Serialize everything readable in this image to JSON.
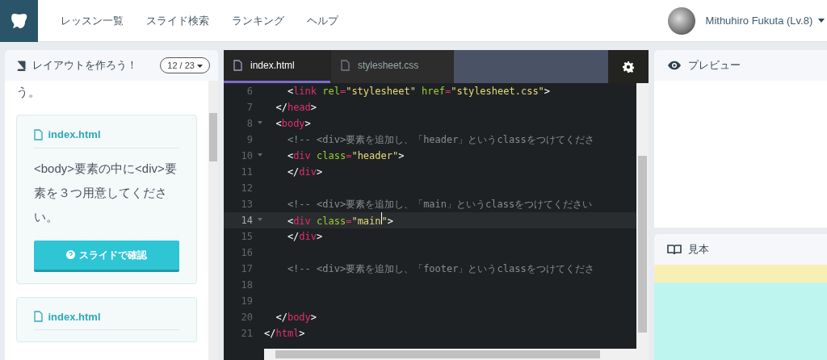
{
  "nav": {
    "items": [
      "レッスン一覧",
      "スライド検索",
      "ランキング",
      "ヘルプ"
    ],
    "user": "Mithuhiro Fukuta (Lv.8)"
  },
  "lesson": {
    "title": "レイアウトを作ろう！",
    "progress": "12 / 23",
    "intro_tail": "う。",
    "cards": [
      {
        "file": "index.html",
        "text": "<body>要素の中に<div>要素を３つ用意してください。",
        "button": "スライドで確認"
      },
      {
        "file": "index.html"
      }
    ]
  },
  "editor": {
    "tabs": [
      {
        "label": "index.html",
        "selected": true
      },
      {
        "label": "stylesheet.css",
        "selected": false
      }
    ],
    "lines": [
      {
        "number": "6",
        "fold": false,
        "active": false,
        "tokens": [
          {
            "kind": "punct",
            "text": "    <"
          },
          {
            "kind": "tag",
            "text": "link"
          },
          {
            "kind": "attr",
            "text": " rel"
          },
          {
            "kind": "tag",
            "text": "="
          },
          {
            "kind": "str",
            "text": "\"stylesheet\""
          },
          {
            "kind": "attr",
            "text": " href"
          },
          {
            "kind": "tag",
            "text": "="
          },
          {
            "kind": "str",
            "text": "\"stylesheet.css\""
          },
          {
            "kind": "punct",
            "text": ">"
          }
        ]
      },
      {
        "number": "7",
        "fold": false,
        "active": false,
        "tokens": [
          {
            "kind": "punct",
            "text": "  </"
          },
          {
            "kind": "tag",
            "text": "head"
          },
          {
            "kind": "punct",
            "text": ">"
          }
        ]
      },
      {
        "number": "8",
        "fold": true,
        "active": false,
        "tokens": [
          {
            "kind": "punct",
            "text": "  <"
          },
          {
            "kind": "tag",
            "text": "body"
          },
          {
            "kind": "punct",
            "text": ">"
          }
        ]
      },
      {
        "number": "9",
        "fold": false,
        "active": false,
        "tokens": [
          {
            "kind": "comment",
            "text": "    <!-- <div>要素を追加し、「header」というclassをつけてくださ"
          }
        ]
      },
      {
        "number": "10",
        "fold": true,
        "active": false,
        "tokens": [
          {
            "kind": "punct",
            "text": "    <"
          },
          {
            "kind": "tag",
            "text": "div"
          },
          {
            "kind": "attr",
            "text": " class"
          },
          {
            "kind": "tag",
            "text": "="
          },
          {
            "kind": "str",
            "text": "\"header\""
          },
          {
            "kind": "punct",
            "text": ">"
          }
        ]
      },
      {
        "number": "11",
        "fold": false,
        "active": false,
        "tokens": [
          {
            "kind": "punct",
            "text": "    </"
          },
          {
            "kind": "tag",
            "text": "div"
          },
          {
            "kind": "punct",
            "text": ">"
          }
        ]
      },
      {
        "number": "12",
        "fold": false,
        "active": false
      },
      {
        "number": "13",
        "fold": false,
        "active": false,
        "tokens": [
          {
            "kind": "comment",
            "text": "    <!-- <div>要素を追加し、「main」というclassをつけてください"
          }
        ]
      },
      {
        "number": "14",
        "fold": true,
        "active": true,
        "tokens": [
          {
            "kind": "punct",
            "text": "    <"
          },
          {
            "kind": "tag",
            "text": "div"
          },
          {
            "kind": "attr",
            "text": " class"
          },
          {
            "kind": "tag",
            "text": "="
          },
          {
            "kind": "str",
            "text": "\"main"
          },
          {
            "kind": "cursor"
          },
          {
            "kind": "str",
            "text": "\""
          },
          {
            "kind": "punct",
            "text": ">"
          }
        ]
      },
      {
        "number": "15",
        "fold": false,
        "active": false,
        "tokens": [
          {
            "kind": "punct",
            "text": "    </"
          },
          {
            "kind": "tag",
            "text": "div"
          },
          {
            "kind": "punct",
            "text": ">"
          }
        ]
      },
      {
        "number": "16",
        "fold": false,
        "active": false
      },
      {
        "number": "17",
        "fold": false,
        "active": false,
        "tokens": [
          {
            "kind": "comment",
            "text": "    <!-- <div>要素を追加し、「footer」というclassをつけてくださ"
          }
        ]
      },
      {
        "number": "18",
        "fold": false,
        "active": false
      },
      {
        "number": "19",
        "fold": false,
        "active": false
      },
      {
        "number": "20",
        "fold": false,
        "active": false,
        "tokens": [
          {
            "kind": "punct",
            "text": "  </"
          },
          {
            "kind": "tag",
            "text": "body"
          },
          {
            "kind": "punct",
            "text": ">"
          }
        ]
      },
      {
        "number": "21",
        "fold": false,
        "active": false,
        "tokens": [
          {
            "kind": "punct",
            "text": "</"
          },
          {
            "kind": "tag",
            "text": "html"
          },
          {
            "kind": "punct",
            "text": ">"
          }
        ]
      }
    ]
  },
  "preview": {
    "title": "プレビュー"
  },
  "sample": {
    "title": "見本"
  }
}
